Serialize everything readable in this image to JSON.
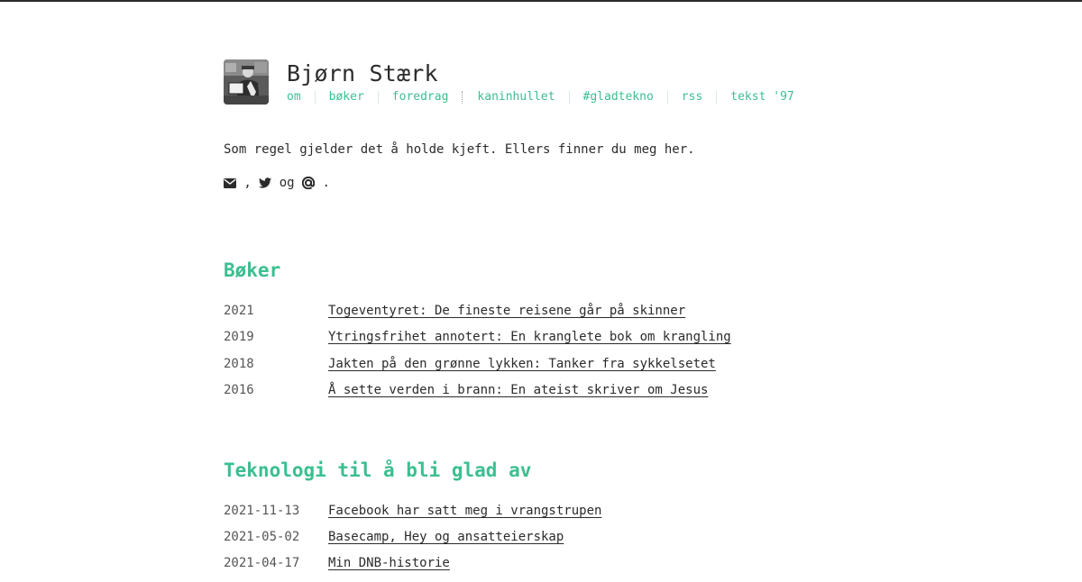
{
  "site": {
    "title": "Bjørn Stærk"
  },
  "nav": {
    "items": [
      {
        "label": "om",
        "sep_style": "solid"
      },
      {
        "label": "bøker",
        "sep_style": "solid"
      },
      {
        "label": "foredrag",
        "sep_style": "dotted"
      },
      {
        "label": "kaninhullet",
        "sep_style": "solid"
      },
      {
        "label": "#gladtekno",
        "sep_style": "solid"
      },
      {
        "label": "rss",
        "sep_style": "solid"
      },
      {
        "label": "tekst '97",
        "sep_style": ""
      }
    ]
  },
  "intro": {
    "text": "Som regel gjelder det å holde kjeft. Ellers finner du meg her."
  },
  "social": {
    "icons": [
      "envelope-icon",
      "twitter-icon",
      "mastodon-icon"
    ],
    "comma": " , ",
    "og": " og ",
    "period": " ."
  },
  "books": {
    "title": "Bøker",
    "items": [
      {
        "year": "2021",
        "title": "Togeventyret: De fineste reisene går på skinner"
      },
      {
        "year": "2019",
        "title": "Ytringsfrihet annotert: En kranglete bok om krangling"
      },
      {
        "year": "2018",
        "title": "Jakten på den grønne lykken: Tanker fra sykkelsetet"
      },
      {
        "year": "2016",
        "title": "Å sette verden i brann: En ateist skriver om Jesus"
      }
    ]
  },
  "tech": {
    "title": "Teknologi til å bli glad av",
    "items": [
      {
        "date": "2021-11-13",
        "title": "Facebook har satt meg i vrangstrupen"
      },
      {
        "date": "2021-05-02",
        "title": "Basecamp, Hey og ansatteierskap"
      },
      {
        "date": "2021-04-17",
        "title": "Min DNB-historie"
      }
    ]
  },
  "colors": {
    "accent": "#3bbf8f",
    "text": "#2b2b2b",
    "muted": "#555555"
  }
}
